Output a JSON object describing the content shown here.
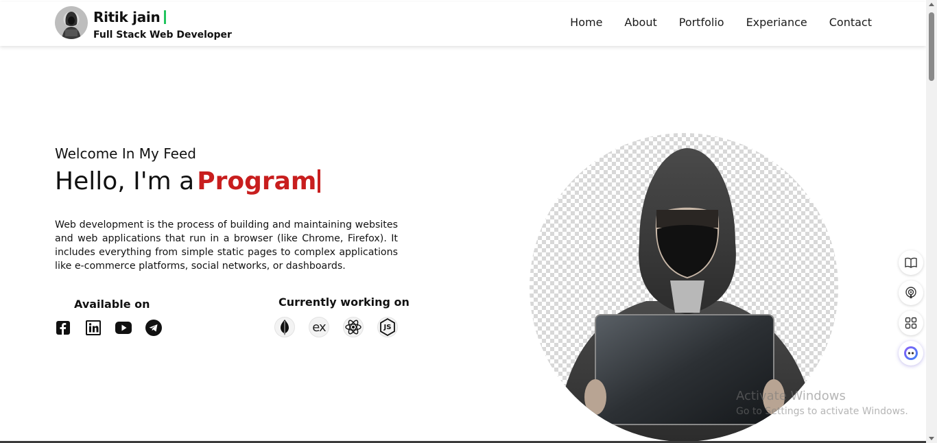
{
  "header": {
    "name": "Ritik jain",
    "subtitle": "Full Stack Web Developer",
    "avatar_icon": "hooded-person-avatar",
    "cursor_color": "#22c55e"
  },
  "nav": {
    "items": [
      {
        "label": "Home"
      },
      {
        "label": "About"
      },
      {
        "label": "Portfolio"
      },
      {
        "label": "Experiance"
      },
      {
        "label": "Contact"
      }
    ]
  },
  "hero": {
    "welcome": "Welcome In My Feed",
    "hello_prefix": "Hello, I'm a",
    "role_typed": "Program",
    "accent_color": "#c81e1e",
    "description": "Web development is the process of building and maintaining websites and web applications that run in a browser (like Chrome, Firefox). It includes everything from simple static pages to complex applications like e-commerce platforms, social networks, or dashboards.",
    "image_icon": "hooded-hacker-with-laptop"
  },
  "available": {
    "title": "Available on",
    "icons": [
      "facebook-icon",
      "linkedin-icon",
      "youtube-icon",
      "telegram-icon"
    ]
  },
  "working": {
    "title": "Currently working on",
    "icons": [
      "mongodb-icon",
      "express-icon",
      "react-icon",
      "nodejs-icon"
    ],
    "express_text": "ex",
    "node_text": "JS"
  },
  "dock": {
    "icons": [
      "book-icon",
      "podcast-icon",
      "apps-icon",
      "assistant-icon"
    ]
  },
  "watermark": {
    "line1": "Activate Windows",
    "line2": "Go to Settings to activate Windows."
  }
}
